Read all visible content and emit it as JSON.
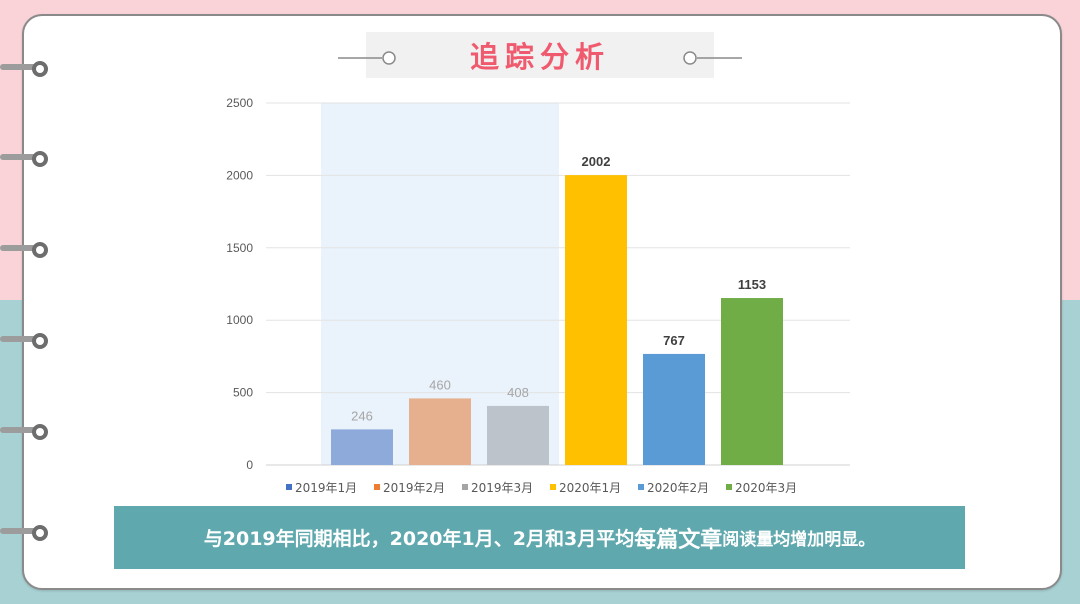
{
  "page": {
    "title": "追踪分析",
    "summary": {
      "part1": "与2019年同期相比，2020年1月、2月和3月平均",
      "emphasis": "每篇文章",
      "part2": "阅读量均增加明显。"
    }
  },
  "colors": {
    "title": "#f05a6e",
    "banner": "#5ea8ae",
    "highlight_band": "#eaf2fb",
    "bg_top": "#f9d3d7",
    "bg_bottom": "#a8d1d4"
  },
  "chart_data": {
    "type": "bar",
    "categories": [
      "2019年1月",
      "2019年2月",
      "2019年3月",
      "2020年1月",
      "2020年2月",
      "2020年3月"
    ],
    "values": [
      246,
      460,
      408,
      2002,
      767,
      1153
    ],
    "colors": [
      "#8eaadb",
      "#e6b08e",
      "#bdc3cb",
      "#ffc000",
      "#5b9bd5",
      "#70ad47"
    ],
    "legend_colors": [
      "#4472c4",
      "#ed7d31",
      "#a5a5a5",
      "#ffc000",
      "#5b9bd5",
      "#70ad47"
    ],
    "label_colors": [
      "#a6a6a6",
      "#a6a6a6",
      "#a6a6a6",
      "#404040",
      "#404040",
      "#404040"
    ],
    "label_bold": [
      false,
      false,
      false,
      true,
      true,
      true
    ],
    "ylim": [
      0,
      2500
    ],
    "yticks": [
      0,
      500,
      1000,
      1500,
      2000,
      2500
    ],
    "highlighted_categories": [
      "2019年1月",
      "2019年2月",
      "2019年3月"
    ],
    "legend_position": "bottom",
    "grid": true,
    "title": "",
    "xlabel": "",
    "ylabel": ""
  }
}
